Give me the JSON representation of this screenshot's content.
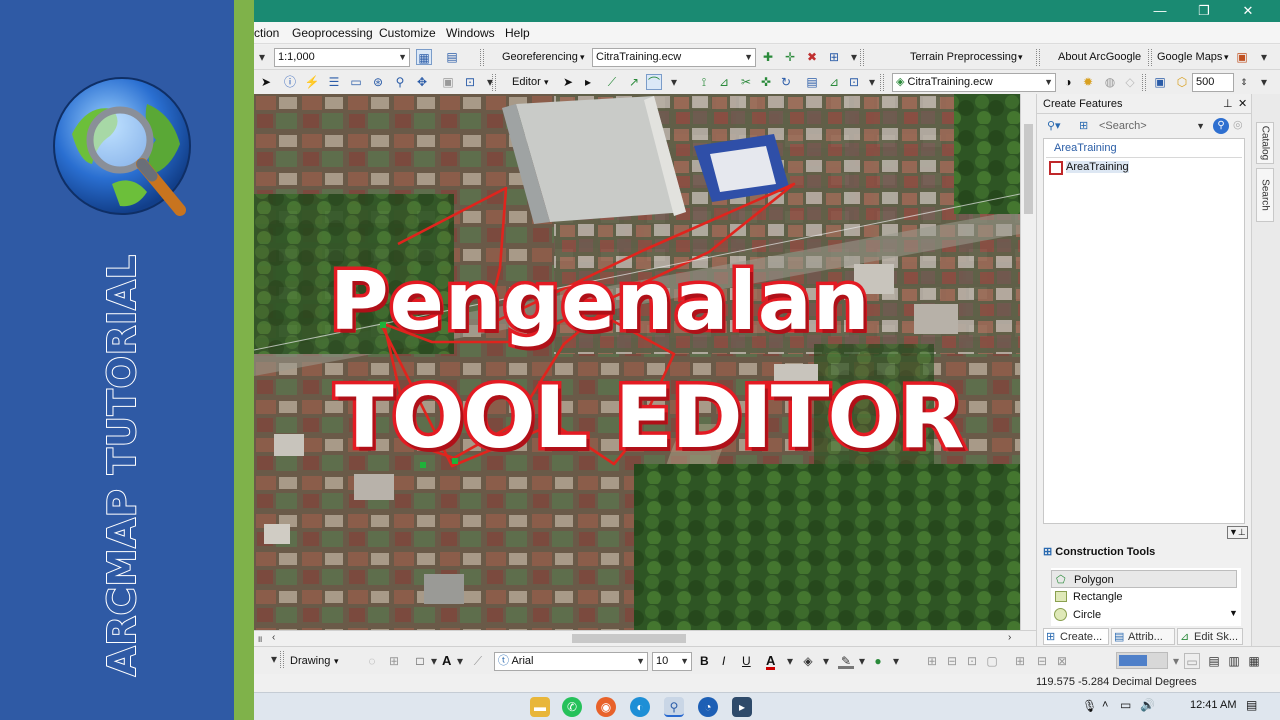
{
  "brand": {
    "title": "ARCMAP TUTORIAL",
    "panel_color": "#2f5aa5",
    "stripe_color": "#7fb24a",
    "icon": "globe-magnifier-icon"
  },
  "window": {
    "titlebar_color": "#1a8a72",
    "controls": [
      "—",
      "❐",
      "✕"
    ]
  },
  "menu": [
    "ction",
    "Geoprocessing",
    "Customize",
    "Windows",
    "Help"
  ],
  "toolbar1": {
    "scale": "1:1,000",
    "georeferencing": "Georeferencing",
    "raster_layer": "CitraTraining.ecw",
    "terrain": "Terrain Preprocessing",
    "about": "About ArcGoogle",
    "google_maps": "Google Maps"
  },
  "toolbar2": {
    "editor": "Editor",
    "layer": "CitraTraining.ecw",
    "value": "500"
  },
  "overlay": {
    "line1": "Pengenalan",
    "line2": "TOOL EDITOR",
    "accent": "#e31b23"
  },
  "create_features": {
    "title": "Create Features",
    "search_placeholder": "<Search>",
    "group": "AreaTraining",
    "template": "AreaTraining"
  },
  "construction_tools": {
    "title": "Construction Tools",
    "items": [
      "Polygon",
      "Rectangle",
      "Circle"
    ]
  },
  "panel_tabs": [
    "Create...",
    "Attrib...",
    "Edit Sk..."
  ],
  "side_tabs": [
    "Catalog",
    "Search"
  ],
  "drawing": {
    "label": "Drawing",
    "font": "Arial",
    "size": "10",
    "bold": "B",
    "italic": "I",
    "underline": "U",
    "font_color_label": "A"
  },
  "status": {
    "coordinates": "119.575  -5.284 Decimal Degrees"
  },
  "taskbar": {
    "time": "12:41 AM"
  }
}
